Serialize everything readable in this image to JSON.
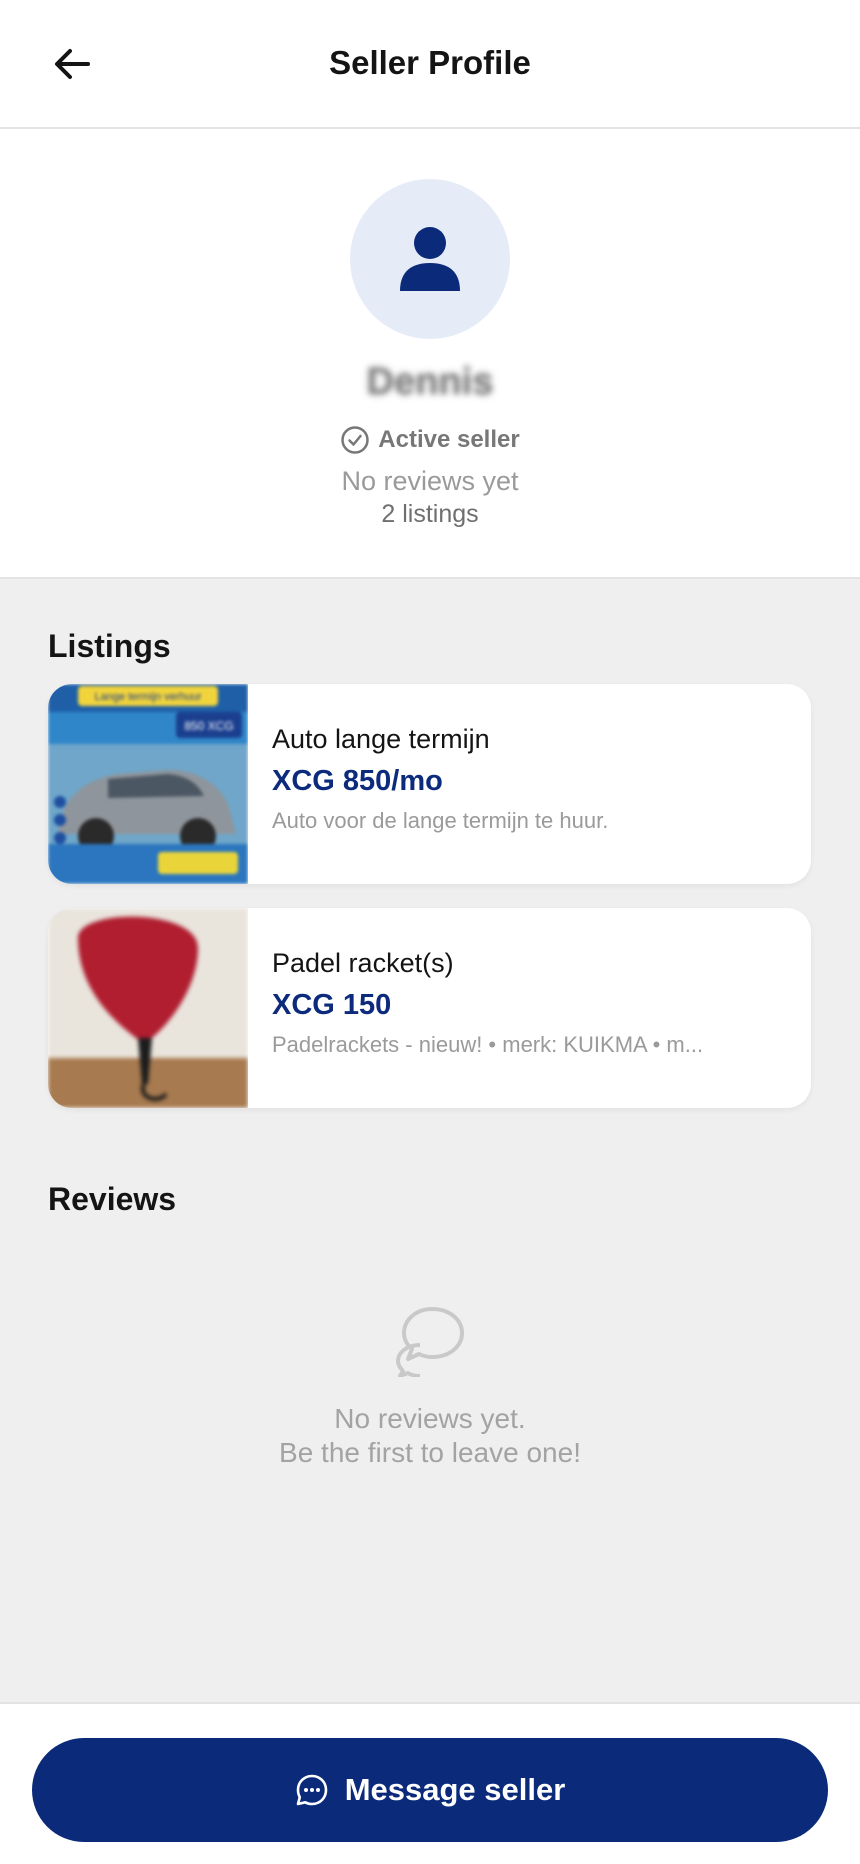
{
  "header": {
    "title": "Seller Profile",
    "back_icon": "arrow-left-icon"
  },
  "profile": {
    "avatar_icon": "person-icon",
    "name": "Dennis",
    "status": {
      "icon": "check-circle-icon",
      "label": "Active seller"
    },
    "reviews_summary": "No reviews yet",
    "listings_count": "2 listings"
  },
  "listings": {
    "heading": "Listings",
    "items": [
      {
        "title": "Auto lange termijn",
        "price": "XCG 850/mo",
        "description": "Auto voor de lange termijn te huur.",
        "image": {
          "banner_text": "Lange termijn verhuur",
          "badge_text": "850 XCG"
        }
      },
      {
        "title": "Padel racket(s)",
        "price": "XCG 150",
        "description": "Padelrackets - nieuw! • merk: KUIKMA • m..."
      }
    ]
  },
  "reviews": {
    "heading": "Reviews",
    "empty_icon": "chat-bubbles-icon",
    "empty_line1": "No reviews yet.",
    "empty_line2": "Be the first to leave one!"
  },
  "footer": {
    "button_label": "Message seller",
    "button_icon": "chat-dots-icon"
  },
  "colors": {
    "accent": "#0b2a7a",
    "price": "#0d2b7d",
    "avatar_bg": "#e6ecf7",
    "page_bg": "#efefef"
  }
}
